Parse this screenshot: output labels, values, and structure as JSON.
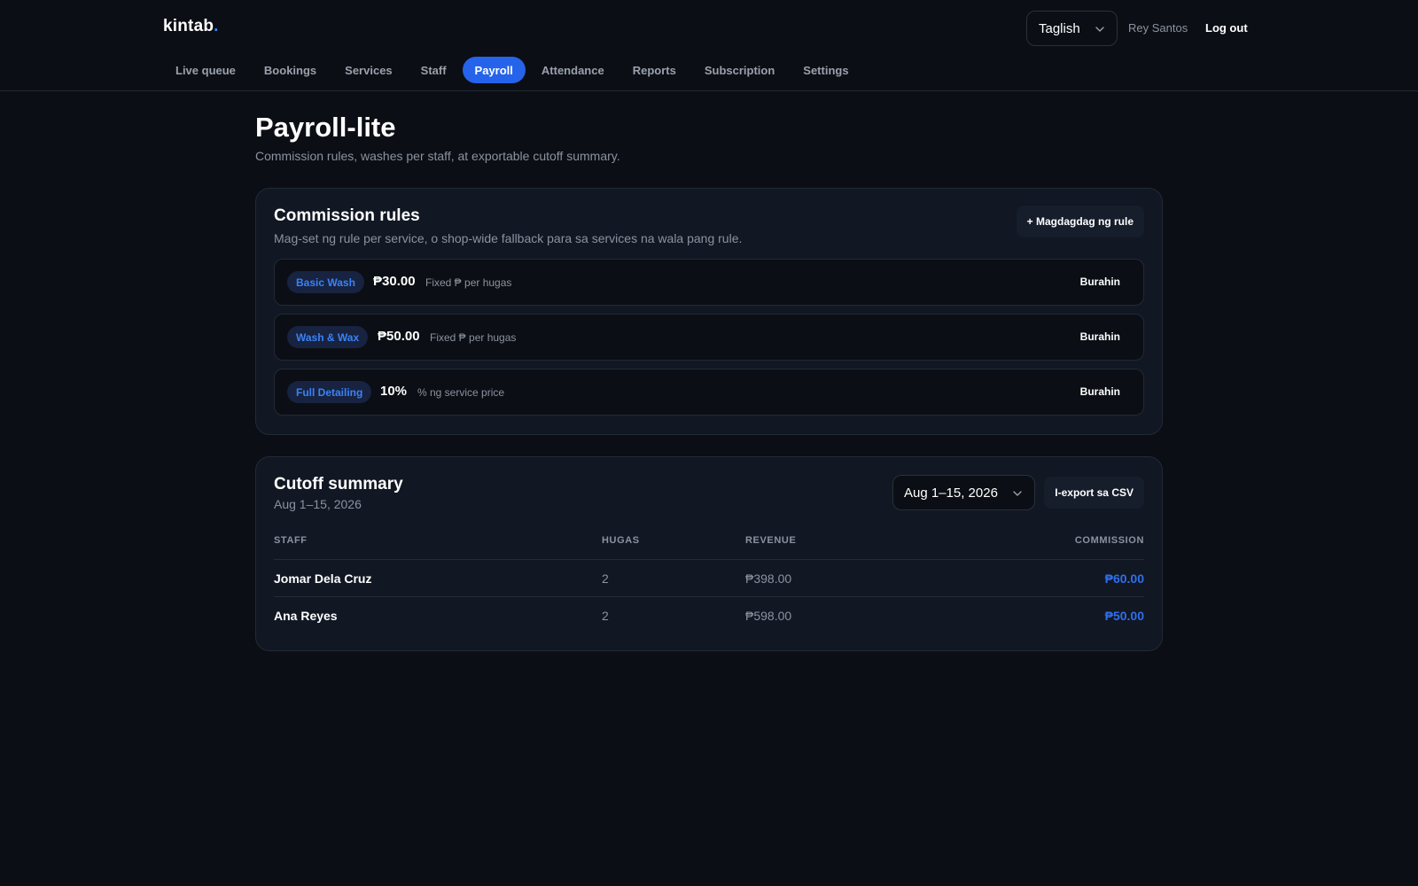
{
  "header": {
    "logo_text": "kintab",
    "logo_dot": ".",
    "language": "Taglish",
    "user_name": "Rey Santos",
    "logout_label": "Log out"
  },
  "nav": {
    "items": [
      {
        "label": "Live queue",
        "active": false
      },
      {
        "label": "Bookings",
        "active": false
      },
      {
        "label": "Services",
        "active": false
      },
      {
        "label": "Staff",
        "active": false
      },
      {
        "label": "Payroll",
        "active": true
      },
      {
        "label": "Attendance",
        "active": false
      },
      {
        "label": "Reports",
        "active": false
      },
      {
        "label": "Subscription",
        "active": false
      },
      {
        "label": "Settings",
        "active": false
      }
    ]
  },
  "page": {
    "title": "Payroll-lite",
    "subtitle": "Commission rules, washes per staff, at exportable cutoff summary."
  },
  "commission_rules": {
    "title": "Commission rules",
    "subtitle": "Mag-set ng rule per service, o shop-wide fallback para sa services na wala pang rule.",
    "add_label": "+ Magdagdag ng rule",
    "rules": [
      {
        "service": "Basic Wash",
        "amount": "₱30.00",
        "type": "Fixed ₱ per hugas",
        "delete_label": "Burahin"
      },
      {
        "service": "Wash & Wax",
        "amount": "₱50.00",
        "type": "Fixed ₱ per hugas",
        "delete_label": "Burahin"
      },
      {
        "service": "Full Detailing",
        "amount": "10%",
        "type": "% ng service price",
        "delete_label": "Burahin"
      }
    ]
  },
  "cutoff_summary": {
    "title": "Cutoff summary",
    "period": "Aug 1–15, 2026",
    "selected_cutoff": "Aug 1–15, 2026",
    "export_label": "I-export sa CSV",
    "columns": {
      "staff": "STAFF",
      "hugas": "HUGAS",
      "revenue": "REVENUE",
      "commission": "COMMISSION"
    },
    "rows": [
      {
        "staff": "Jomar Dela Cruz",
        "hugas": "2",
        "revenue": "₱398.00",
        "commission": "₱60.00"
      },
      {
        "staff": "Ana Reyes",
        "hugas": "2",
        "revenue": "₱598.00",
        "commission": "₱50.00"
      }
    ]
  },
  "colors": {
    "background": "#0b0e14",
    "card": "#111723",
    "accent": "#2563eb",
    "accent_text": "#3b82f6",
    "muted": "#8b93a1"
  },
  "icons": {
    "language_select": "chevron-down-icon",
    "cutoff_select": "chevron-down-icon"
  }
}
